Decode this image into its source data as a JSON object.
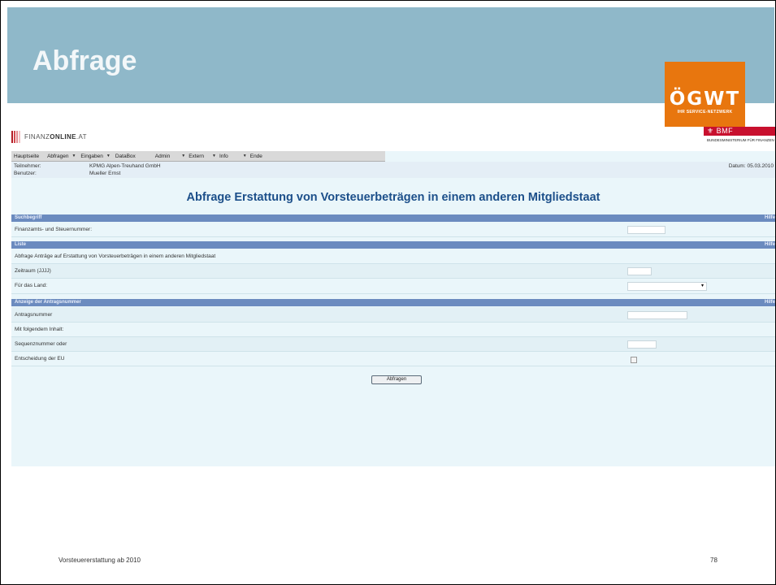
{
  "slide": {
    "title": "Abfrage",
    "footer_text": "Vorsteuererstattung ab 2010",
    "page_number": "78"
  },
  "logo_ogwt": {
    "name": "ÖGWT",
    "tagline": "IHR SERVICE-NETZWERK",
    "color": "#e8760e"
  },
  "finanzonline": {
    "logo_thin": "FINANZ",
    "logo_bold": "ONLINE",
    "logo_suffix": ".AT",
    "bmf_logo": "BMF",
    "bmf_sub": "BUNDESMINISTERIUM FÜR FINANZEN"
  },
  "menu": {
    "items": [
      {
        "label": "Hauptseite",
        "arrow": false
      },
      {
        "label": "Abfragen",
        "arrow": true
      },
      {
        "label": "Eingaben",
        "arrow": true
      },
      {
        "label": "DataBox",
        "arrow": false
      },
      {
        "label": "Admin",
        "arrow": true
      },
      {
        "label": "Extern",
        "arrow": true
      },
      {
        "label": "Info",
        "arrow": true
      },
      {
        "label": "Ende",
        "arrow": false
      }
    ]
  },
  "info": {
    "teilnehmer_label": "Teilnehmer:",
    "teilnehmer_value": "KPMG Alpen-Treuhand GmbH",
    "benutzer_label": "Benutzer:",
    "benutzer_value": "Mueller Ernst",
    "datum": "Datum: 05.03.2010"
  },
  "heading": "Abfrage Erstattung von Vorsteuerbeträgen in einem anderen Mitgliedstaat",
  "sections": {
    "suchbegriff": "Suchbegriff",
    "liste": "Liste",
    "anzeige": "Anzeige der Antragsnummer",
    "hilfe": "Hilfe"
  },
  "fields": {
    "finanzamt": "Finanzamts- und Steuernummer:",
    "liste_desc": "Abfrage Anträge auf Erstattung von Vorsteuerbeträgen in einem anderen Mitgliedstaat",
    "zeitraum": "Zeitraum (JJJJ)",
    "land": "Für das Land:",
    "land_value": "",
    "antragsnummer": "Antragsnummer",
    "inhalt": "Mit folgendem Inhalt:",
    "sequenz": "Sequenznummer oder",
    "entscheidung": "Entscheidung der EU"
  },
  "button": {
    "abfragen": "Abfragen"
  }
}
